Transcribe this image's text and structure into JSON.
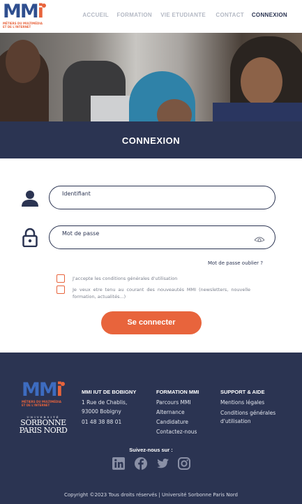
{
  "header": {
    "logo_text": "MMi",
    "logo_tagline_line1": "MÉTIERS DU MULTIMÉDIA",
    "logo_tagline_line2": "ET DE L'INTERNET",
    "nav": [
      {
        "label": "ACCUEIL",
        "active": false
      },
      {
        "label": "FORMATION",
        "active": false
      },
      {
        "label": "VIE ETUDIANTE",
        "active": false
      },
      {
        "label": "CONTACT",
        "active": false
      },
      {
        "label": "CONNEXION",
        "active": true
      }
    ]
  },
  "banner": {
    "title": "CONNEXION"
  },
  "form": {
    "username": {
      "label": "Identifiant",
      "value": ""
    },
    "password": {
      "label": "Mot de passe",
      "value": ""
    },
    "forgot_link": "Mot de passe oublier ?",
    "checkboxes": [
      {
        "label": "J'accepte les conditions générales d'utilisation",
        "checked": false
      },
      {
        "label": "Je veux etre tenu au courant des nouveautés MMI (newsletters, nouvelle formation, actualités...)",
        "checked": false
      }
    ],
    "submit_label": "Se connecter"
  },
  "footer": {
    "university_line1": "UNIVERSITÉ",
    "university_line2": "SORBONNE",
    "university_line3": "PARIS NORD",
    "columns": [
      {
        "title": "MMI IUT DE BOBIGNY",
        "lines": [
          "1 Rue de Chablis,",
          "93000 Bobigny",
          "01 48 38 88 01"
        ]
      },
      {
        "title": "FORMATION MMI",
        "lines": [
          "Parcours MMI",
          "Alternance",
          "Candidature",
          "Contactez-nous"
        ]
      },
      {
        "title": "SUPPORT & AIDE",
        "lines": [
          "Mentions légales",
          "Conditions générales",
          "d'utilisation"
        ]
      }
    ],
    "follow_title": "Suivez-nous sur :",
    "social": [
      "linkedin-icon",
      "facebook-icon",
      "twitter-icon",
      "instagram-icon"
    ],
    "copyright": "Copyright ©2023 Tous droits réservés | Université Sorbonne Paris Nord"
  },
  "colors": {
    "navy": "#2b3452",
    "accent": "#e8643c",
    "brand_blue": "#2f4f8f"
  }
}
